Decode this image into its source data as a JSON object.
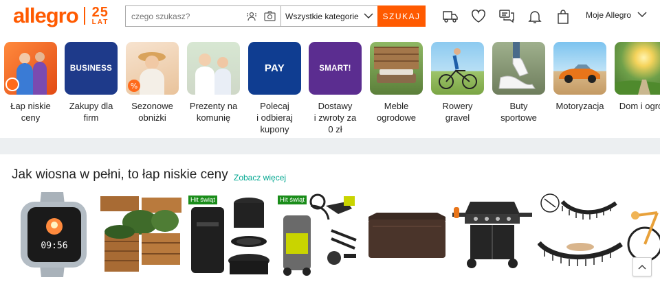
{
  "header": {
    "logo": "allegro",
    "logo_badge_number": "25",
    "logo_badge_text": "LAT",
    "search_placeholder": "czego szukasz?",
    "category_selected": "Wszystkie kategorie",
    "search_button": "SZUKAJ",
    "account_label": "Moje Allegro",
    "icons": [
      "truck-icon",
      "heart-icon",
      "chat-icon",
      "bell-icon",
      "shopping-bag-icon"
    ]
  },
  "categories": [
    {
      "label_lines": [
        "Łap niskie",
        "ceny"
      ],
      "tile": "photo"
    },
    {
      "label_lines": [
        "Zakupy dla",
        "firm"
      ],
      "tile_text": "BUSINESS"
    },
    {
      "label_lines": [
        "Sezonowe",
        "obniżki"
      ],
      "tile": "photo"
    },
    {
      "label_lines": [
        "Prezenty na",
        "komunię"
      ],
      "tile": "photo"
    },
    {
      "label_lines": [
        "Polecaj",
        "i odbieraj",
        "kupony"
      ],
      "tile_text": "PAY"
    },
    {
      "label_lines": [
        "Dostawy",
        "i zwroty za",
        "0 zł"
      ],
      "tile_text": "SMART!"
    },
    {
      "label_lines": [
        "Meble",
        "ogrodowe"
      ],
      "tile": "photo"
    },
    {
      "label_lines": [
        "Rowery",
        "gravel"
      ],
      "tile": "photo"
    },
    {
      "label_lines": [
        "Buty",
        "sportowe"
      ],
      "tile": "photo"
    },
    {
      "label_lines": [
        "Motoryzacja"
      ],
      "tile": "photo"
    },
    {
      "label_lines": [
        "Dom i ogró"
      ],
      "tile": "photo"
    }
  ],
  "section": {
    "title": "Jak wiosna w pełni, to łap niskie ceny",
    "see_more": "Zobacz więcej",
    "badge": "Hit świąt"
  },
  "colors": {
    "brand": "#ff5a00",
    "link": "#00a790",
    "business": "#1e3a8a",
    "pay": "#0f3d91",
    "smart": "#5b2d90",
    "badge": "#1a8d1a"
  }
}
